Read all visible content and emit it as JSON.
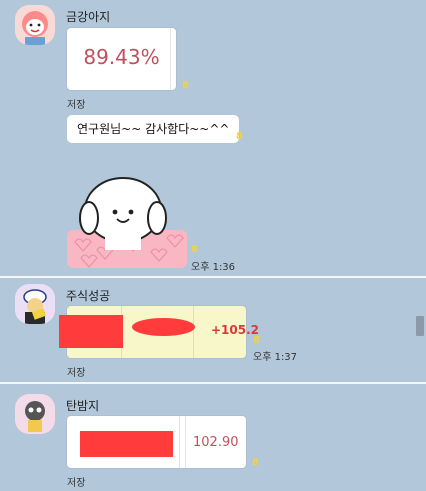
{
  "messages": [
    {
      "sender": "금강아지",
      "percent_image_text": "89.43%",
      "unread": "8",
      "save_label": "저장",
      "text_bubble": "연구원님~~ 감사함다~~^^",
      "text_unread": "8",
      "sticker_unread": "8",
      "time": "오후 1:36"
    },
    {
      "sender": "주식성공",
      "amount_text": "+105.2",
      "unread": "8",
      "time": "오후 1:37",
      "save_label": "저장"
    },
    {
      "sender": "탄밤지",
      "value_text": "102.90",
      "unread": "8",
      "save_label": "저장"
    }
  ],
  "colors": {
    "background": "#b2c7d9",
    "divider": "#f4f6f8",
    "unread": "#f2d23f",
    "redaction": "#ff3b3b",
    "percent_text": "#c0505c"
  }
}
